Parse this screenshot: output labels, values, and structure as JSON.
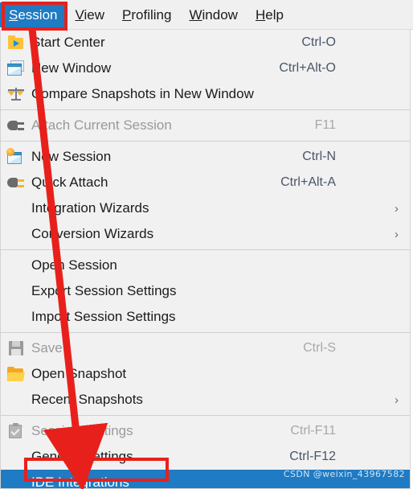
{
  "menubar": {
    "items": [
      {
        "label": "Session",
        "mnemonic": "S",
        "selected": true
      },
      {
        "label": "View",
        "mnemonic": "V",
        "selected": false
      },
      {
        "label": "Profiling",
        "mnemonic": "P",
        "selected": false
      },
      {
        "label": "Window",
        "mnemonic": "W",
        "selected": false
      },
      {
        "label": "Help",
        "mnemonic": "H",
        "selected": false
      }
    ]
  },
  "menu": {
    "groups": [
      {
        "items": [
          {
            "icon": "folder-play-icon",
            "label": "Start Center",
            "accel": "Ctrl-O",
            "disabled": false,
            "submenu": false
          },
          {
            "icon": "new-window-icon",
            "label": "New Window",
            "accel": "Ctrl+Alt-O",
            "disabled": false,
            "submenu": false
          },
          {
            "icon": "scales-icon",
            "label": "Compare Snapshots in New Window",
            "accel": "",
            "disabled": false,
            "submenu": false
          }
        ]
      },
      {
        "items": [
          {
            "icon": "plug-icon",
            "label": "Attach Current Session",
            "accel": "F11",
            "disabled": true,
            "submenu": false
          }
        ]
      },
      {
        "items": [
          {
            "icon": "new-session-icon",
            "label": "New Session",
            "accel": "Ctrl-N",
            "disabled": false,
            "submenu": false
          },
          {
            "icon": "plug-gold-icon",
            "label": "Quick Attach",
            "accel": "Ctrl+Alt-A",
            "disabled": false,
            "submenu": false
          },
          {
            "icon": "none",
            "label": "Integration Wizards",
            "accel": "",
            "disabled": false,
            "submenu": true
          },
          {
            "icon": "none",
            "label": "Conversion Wizards",
            "accel": "",
            "disabled": false,
            "submenu": true
          }
        ]
      },
      {
        "items": [
          {
            "icon": "none",
            "label": "Open Session",
            "accel": "",
            "disabled": false,
            "submenu": false
          },
          {
            "icon": "none",
            "label": "Export Session Settings",
            "accel": "",
            "disabled": false,
            "submenu": false
          },
          {
            "icon": "none",
            "label": "Import Session Settings",
            "accel": "",
            "disabled": false,
            "submenu": false
          }
        ]
      },
      {
        "items": [
          {
            "icon": "save-icon",
            "label": "Save",
            "accel": "Ctrl-S",
            "disabled": true,
            "submenu": false
          },
          {
            "icon": "open-folder-icon",
            "label": "Open Snapshot",
            "accel": "",
            "disabled": false,
            "submenu": false
          },
          {
            "icon": "none",
            "label": "Recent Snapshots",
            "accel": "",
            "disabled": false,
            "submenu": true
          }
        ]
      },
      {
        "items": [
          {
            "icon": "clipboard-check-icon",
            "label": "Session Settings",
            "accel": "Ctrl-F11",
            "disabled": true,
            "submenu": false
          },
          {
            "icon": "none",
            "label": "General Settings",
            "accel": "Ctrl-F12",
            "disabled": false,
            "submenu": false
          },
          {
            "icon": "none",
            "label": "IDE Integrations",
            "accel": "",
            "disabled": false,
            "submenu": false,
            "highlight": true
          }
        ]
      }
    ]
  },
  "watermark": {
    "text": "CSDN @weixin_43967582"
  },
  "annotations": {
    "box_session_label": "Session",
    "box_ide_label": "IDE Integrations",
    "arrow_color": "#e8201b"
  },
  "colors": {
    "accent": "#1e7bc4",
    "menu_bg": "#f1f1f1",
    "menubar_bg": "#f0f0f0",
    "separator": "#d0d0d0",
    "disabled_text": "#9a9a9a",
    "accel_text": "#4a5568",
    "annotation_red": "#e8201b"
  }
}
